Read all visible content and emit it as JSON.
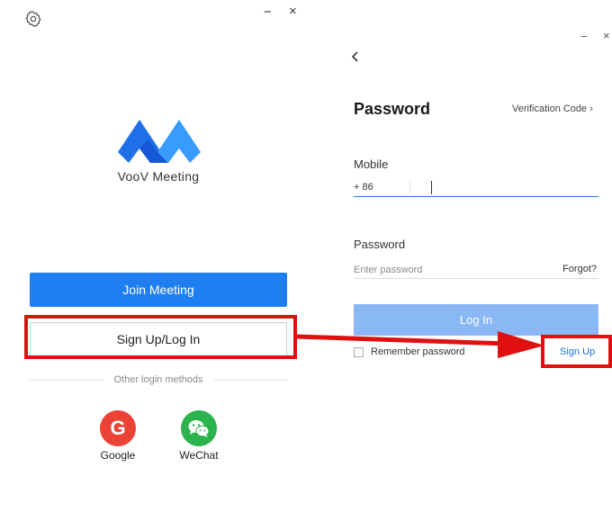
{
  "left_window": {
    "brand_name": "VooV Meeting",
    "join_meeting_label": "Join Meeting",
    "signup_login_label": "Sign Up/Log In",
    "other_methods_label": "Other login methods",
    "google_label": "Google",
    "google_glyph": "G",
    "wechat_label": "WeChat",
    "minimize_glyph": "−",
    "close_glyph": "×"
  },
  "right_window": {
    "title": "Password",
    "verification_link": "Verification Code ›",
    "mobile_label": "Mobile",
    "country_code": "+ 86",
    "mobile_value": "",
    "password_label": "Password",
    "password_placeholder": "Enter password",
    "forgot_label": "Forgot?",
    "login_label": "Log In",
    "remember_label": "Remember password",
    "signup_label": "Sign Up",
    "minimize_glyph": "−",
    "close_glyph": "×"
  },
  "icons": {
    "settings": "gear-icon",
    "back": "chevron-left-icon",
    "logo": "voov-logo",
    "google": "google-icon",
    "wechat": "wechat-icon"
  },
  "colors": {
    "primary": "#1f7ff0",
    "login_disabled": "#8ab8f5",
    "link": "#1a6fe0",
    "google": "#ea4335",
    "wechat": "#2bb34c",
    "annotation": "#e01010"
  }
}
